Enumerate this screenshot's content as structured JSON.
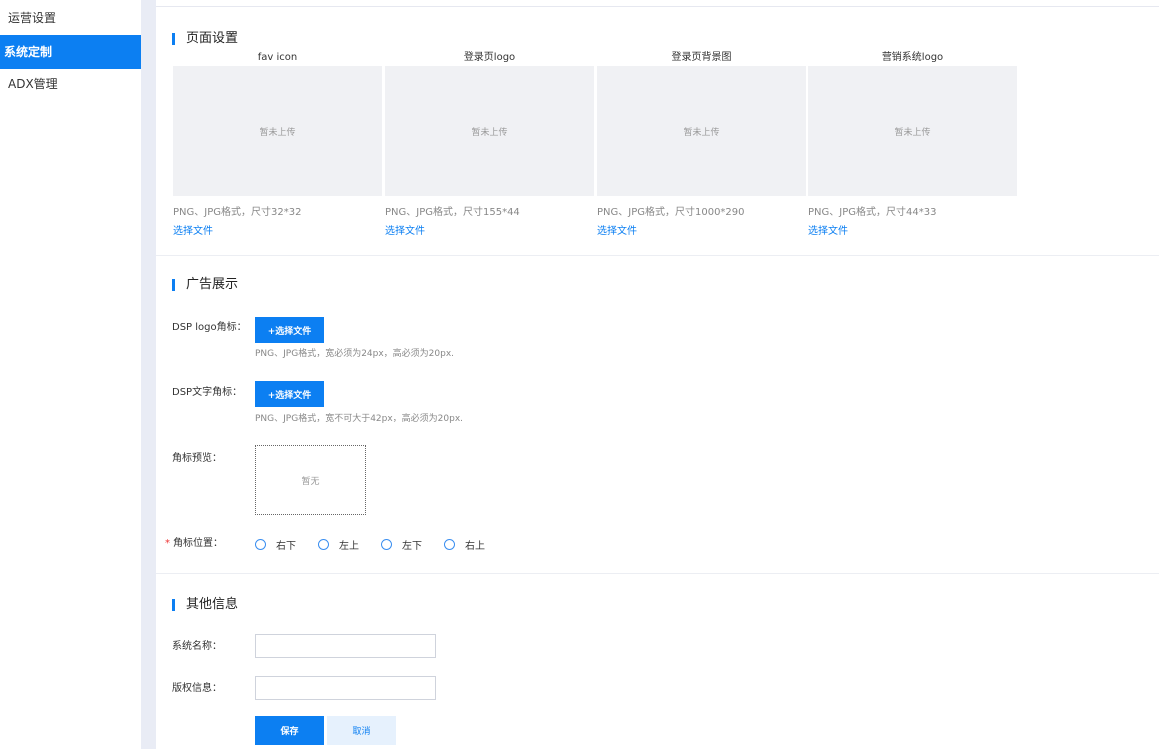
{
  "sidebar": {
    "items": [
      {
        "label": "运营设置"
      },
      {
        "label": "系统定制"
      },
      {
        "label": "ADX管理"
      }
    ]
  },
  "page_settings": {
    "title": "页面设置",
    "uploads": [
      {
        "title": "fav icon",
        "placeholder": "暂未上传",
        "hint": "PNG、JPG格式，尺寸32*32",
        "link": "选择文件"
      },
      {
        "title": "登录页logo",
        "placeholder": "暂未上传",
        "hint": "PNG、JPG格式，尺寸155*44",
        "link": "选择文件"
      },
      {
        "title": "登录页背景图",
        "placeholder": "暂未上传",
        "hint": "PNG、JPG格式，尺寸1000*290",
        "link": "选择文件"
      },
      {
        "title": "营销系统logo",
        "placeholder": "暂未上传",
        "hint": "PNG、JPG格式，尺寸44*33",
        "link": "选择文件"
      }
    ]
  },
  "ad_display": {
    "title": "广告展示",
    "dsp_logo": {
      "label": "DSP logo角标：",
      "button": "+选择文件",
      "hint": "PNG、JPG格式，宽必须为24px，高必须为20px."
    },
    "dsp_text": {
      "label": "DSP文字角标：",
      "button": "+选择文件",
      "hint": "PNG、JPG格式，宽不可大于42px，高必须为20px."
    },
    "preview": {
      "label": "角标预览：",
      "empty": "暂无"
    },
    "position": {
      "required_mark": "*",
      "label": "角标位置：",
      "options": [
        "右下",
        "左上",
        "左下",
        "右上"
      ]
    }
  },
  "other_info": {
    "title": "其他信息",
    "system_name": {
      "label": "系统名称：",
      "value": ""
    },
    "copyright": {
      "label": "版权信息：",
      "value": ""
    },
    "save": "保存",
    "cancel": "取消"
  },
  "colors": {
    "accent": "#0c7ff2",
    "divider": "#e9ecf5",
    "upload_bg": "#f0f1f4"
  }
}
